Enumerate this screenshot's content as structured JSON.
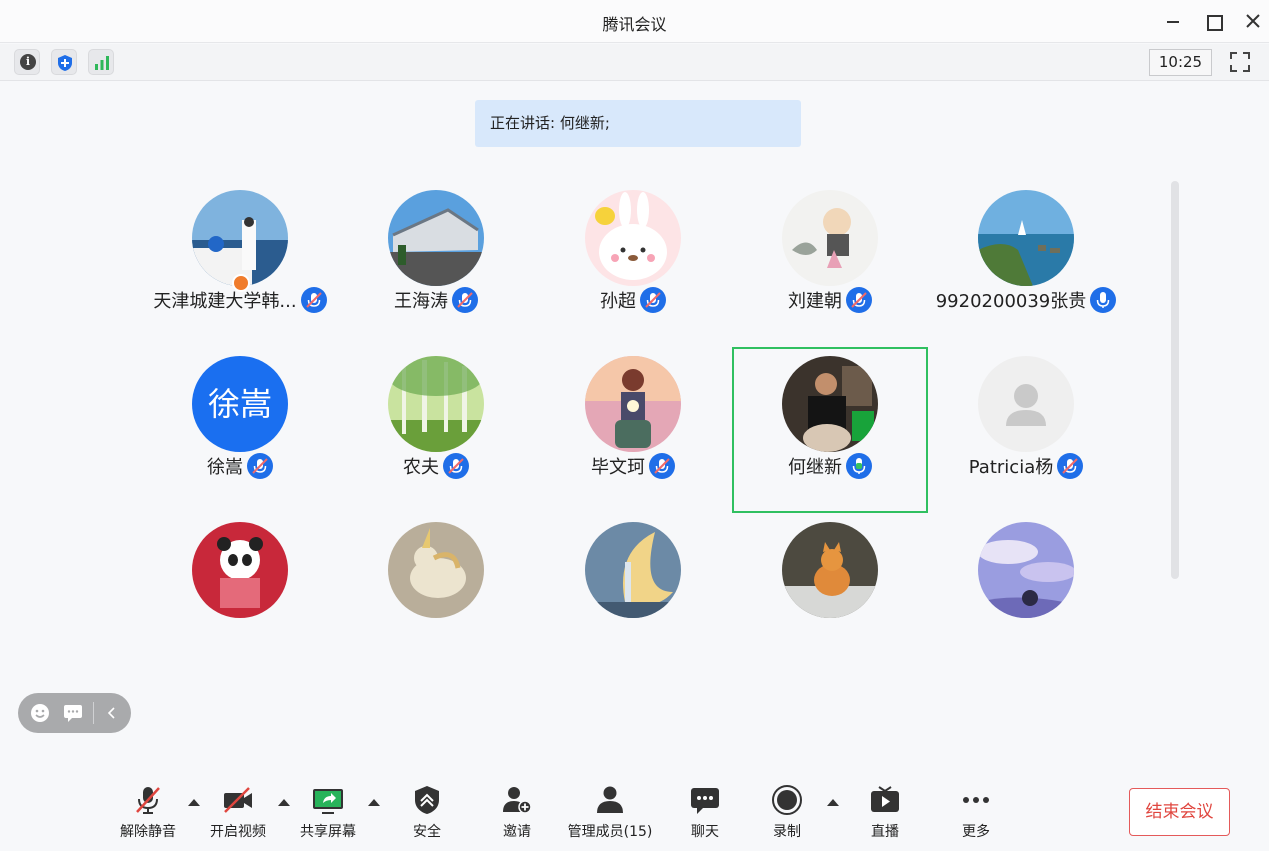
{
  "window": {
    "title": "腾讯会议"
  },
  "toolbar": {
    "clock": "10:25"
  },
  "speaker_banner": "正在讲话: 何继新;",
  "participants": [
    {
      "name": "天津城建大学韩...",
      "mic": "muted",
      "avatar": "photo-seaside",
      "host": true
    },
    {
      "name": "王海涛",
      "mic": "muted",
      "avatar": "photo-building"
    },
    {
      "name": "孙超",
      "mic": "muted",
      "avatar": "cartoon-bunny"
    },
    {
      "name": "刘建朝",
      "mic": "muted",
      "avatar": "ink-painting-monk"
    },
    {
      "name": "9920200039张贵",
      "mic": "on",
      "avatar": "photo-coast"
    },
    {
      "name": "徐嵩",
      "mic": "muted",
      "avatar": "text",
      "avatar_text": "徐嵩",
      "avatar_color": "#1a6ff0"
    },
    {
      "name": "农夫",
      "mic": "muted",
      "avatar": "forest"
    },
    {
      "name": "毕文珂",
      "mic": "muted",
      "avatar": "scooter-cartoon"
    },
    {
      "name": "何继新",
      "mic": "speaking",
      "avatar": "photo-person",
      "active": true
    },
    {
      "name": "Patricia杨",
      "mic": "muted",
      "avatar": "default-person"
    },
    {
      "name": "",
      "avatar": "panda-cartoon"
    },
    {
      "name": "",
      "avatar": "unicorn"
    },
    {
      "name": "",
      "avatar": "moon-fantasy"
    },
    {
      "name": "",
      "avatar": "cat-photo"
    },
    {
      "name": "",
      "avatar": "purple-sky"
    }
  ],
  "controls": {
    "unmute": "解除静音",
    "start_video": "开启视频",
    "share_screen": "共享屏幕",
    "security": "安全",
    "invite": "邀请",
    "manage_members": "管理成员(15)",
    "chat": "聊天",
    "record": "录制",
    "live": "直播",
    "more": "更多",
    "end_meeting": "结束会议"
  },
  "colors": {
    "accent": "#1f6ee8",
    "active_border": "#30c060",
    "end_red": "#e0463f",
    "banner_bg": "#d8e8fb"
  }
}
